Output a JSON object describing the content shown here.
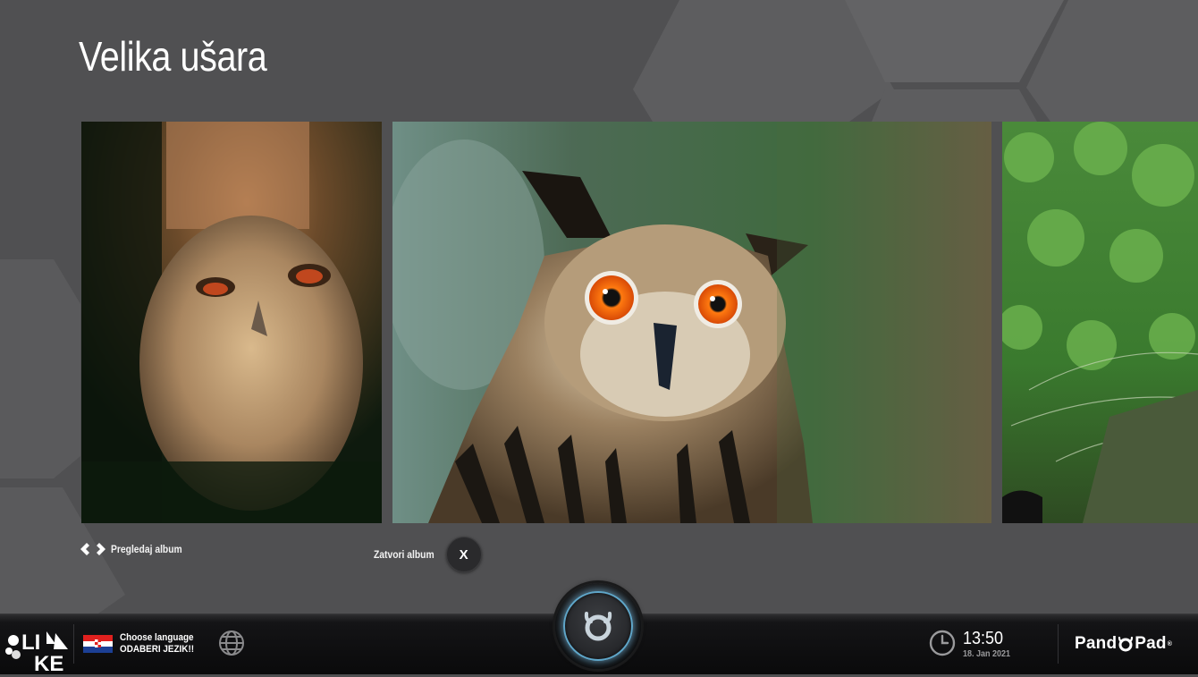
{
  "album": {
    "title": "Velika ušara"
  },
  "photos": [
    {
      "name": "owl-chick-photo"
    },
    {
      "name": "eagle-owl-photo"
    },
    {
      "name": "forest-photo"
    }
  ],
  "controls": {
    "browse_label": "Pregledaj album",
    "close_label": "Zatvori album",
    "close_button": "X"
  },
  "taskbar": {
    "logo_text_top": "LI",
    "logo_text_bottom": "KE",
    "language_title": "Choose language",
    "language_subtitle": "ODABERI JEZIK!!",
    "time": "13:50",
    "date": "18. Jan 2021",
    "brand_left": "Pand",
    "brand_right": "Pad",
    "brand_tm": "®"
  },
  "colors": {
    "background": "#505052",
    "hex_light": "#5e5e60",
    "accent_glow": "#5fa6c9",
    "taskbar": "#0a0a0b"
  },
  "icons": {
    "browse": "double-chevron-icon",
    "language": "croatia-flag-icon",
    "globe": "globe-icon",
    "clock": "clock-icon",
    "home": "pandopad-home-icon"
  }
}
